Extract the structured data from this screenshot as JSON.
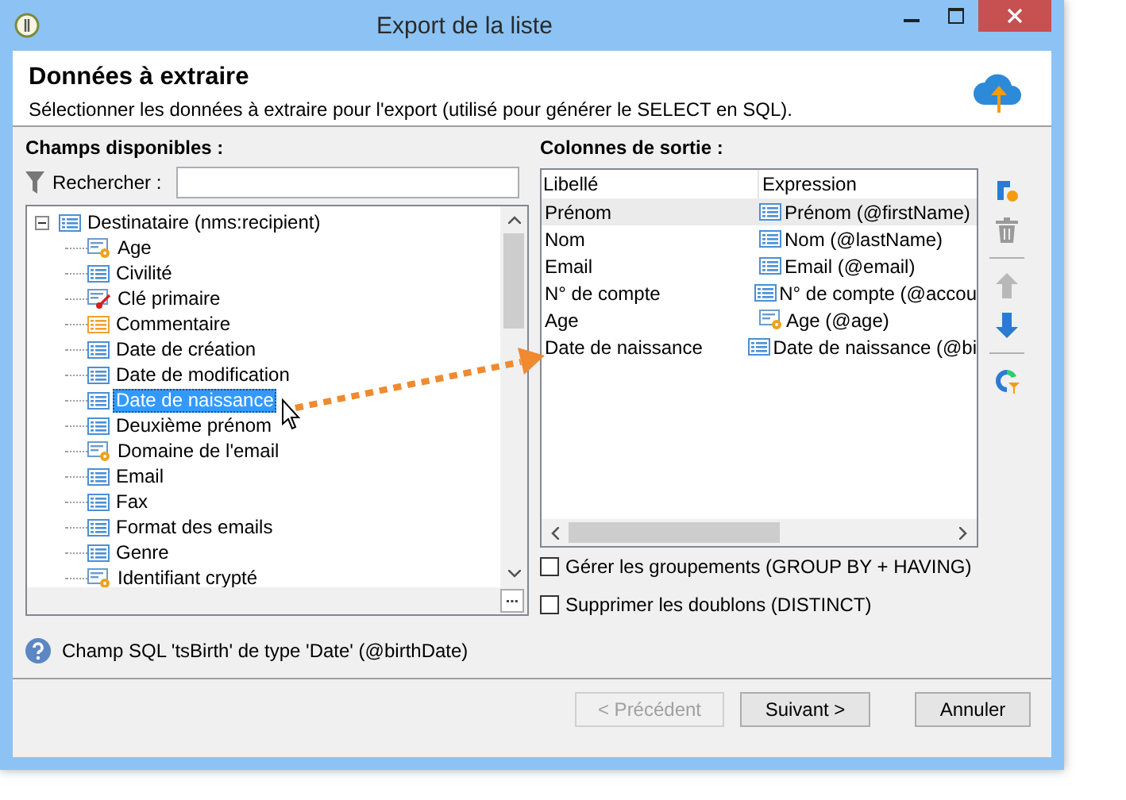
{
  "window": {
    "title": "Export de la liste"
  },
  "header": {
    "title": "Données à extraire",
    "subtitle": "Sélectionner les données à extraire pour l'export (utilisé pour générer le SELECT en SQL)."
  },
  "available": {
    "label": "Champs disponibles :",
    "search": {
      "label": "Rechercher :"
    },
    "tree": {
      "label": "Destinataire (nms:recipient)",
      "expanded": true,
      "children": [
        {
          "label": "Age",
          "kind": "computed",
          "selected": false
        },
        {
          "label": "Civilité",
          "kind": "field",
          "selected": false
        },
        {
          "label": "Clé primaire",
          "kind": "key",
          "selected": false
        },
        {
          "label": "Commentaire",
          "kind": "memo",
          "selected": false
        },
        {
          "label": "Date de création",
          "kind": "field",
          "selected": false
        },
        {
          "label": "Date de modification",
          "kind": "field",
          "selected": false
        },
        {
          "label": "Date de naissance",
          "kind": "field",
          "selected": true
        },
        {
          "label": "Deuxième prénom",
          "kind": "field",
          "selected": false
        },
        {
          "label": "Domaine de l'email",
          "kind": "computed",
          "selected": false
        },
        {
          "label": "Email",
          "kind": "field",
          "selected": false
        },
        {
          "label": "Fax",
          "kind": "field",
          "selected": false
        },
        {
          "label": "Format des emails",
          "kind": "field",
          "selected": false
        },
        {
          "label": "Genre",
          "kind": "field",
          "selected": false
        },
        {
          "label": "Identifiant crypté",
          "kind": "computed",
          "selected": false
        }
      ]
    }
  },
  "output": {
    "label": "Colonnes de sortie :",
    "columns": [
      "Libellé",
      "Expression"
    ],
    "rows": [
      {
        "label": "Prénom",
        "expression": "Prénom (@firstName)",
        "kind": "field",
        "selected": true
      },
      {
        "label": "Nom",
        "expression": "Nom (@lastName)",
        "kind": "field",
        "selected": false
      },
      {
        "label": "Email",
        "expression": "Email (@email)",
        "kind": "field",
        "selected": false
      },
      {
        "label": "N° de compte",
        "expression": "N° de compte (@accou",
        "kind": "field",
        "selected": false
      },
      {
        "label": "Age",
        "expression": "Age (@age)",
        "kind": "computed",
        "selected": false
      },
      {
        "label": "Date de naissance",
        "expression": "Date de naissance (@bi",
        "kind": "field",
        "selected": false
      }
    ],
    "toolbar": [
      {
        "kind": "add",
        "disabled": false
      },
      {
        "kind": "delete",
        "disabled": true
      },
      {
        "kind": "up",
        "disabled": true
      },
      {
        "kind": "down",
        "disabled": false
      },
      {
        "kind": "filter",
        "disabled": false
      }
    ],
    "options": [
      {
        "label": "Gérer les groupements (GROUP BY + HAVING)",
        "checked": false
      },
      {
        "label": "Supprimer les doublons (DISTINCT)",
        "checked": false
      }
    ]
  },
  "status": "Champ SQL 'tsBirth' de type 'Date' (@birthDate)",
  "buttons": [
    {
      "label": "< Précédent",
      "disabled": true
    },
    {
      "label": "Suivant >",
      "disabled": false
    },
    {
      "label": "Annuler",
      "disabled": false
    }
  ]
}
